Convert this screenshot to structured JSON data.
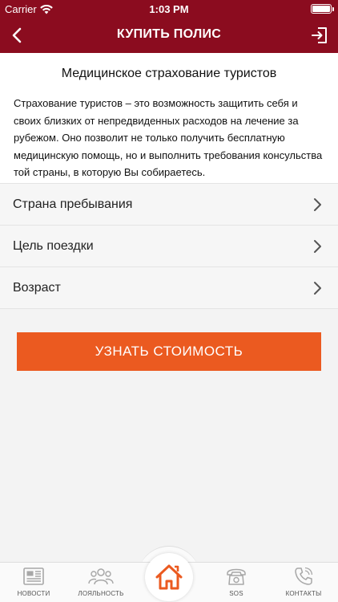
{
  "status_bar": {
    "carrier": "Carrier",
    "time": "1:03 PM"
  },
  "nav": {
    "title": "КУПИТЬ ПОЛИС",
    "back_icon": "chevron-left-icon",
    "exit_icon": "logout-icon"
  },
  "content": {
    "heading": "Медицинское страхование туристов",
    "intro": "Страхование туристов – это возможность защитить себя и своих близких от непредвиденных расходов на лечение за рубежом. Оно позволит не только получить бесплатную медицинскую помощь, но и выполнить требования консульства той страны, в которую Вы собираетесь."
  },
  "options": [
    {
      "label": "Страна пребывания"
    },
    {
      "label": "Цель поездки"
    },
    {
      "label": "Возраст"
    }
  ],
  "cta": {
    "label": "УЗНАТЬ СТОИМОСТЬ"
  },
  "tabs": [
    {
      "label": "НОВОСТИ",
      "icon": "newspaper-icon"
    },
    {
      "label": "ЛОЯЛЬНОСТЬ",
      "icon": "people-icon"
    },
    {
      "label": "",
      "icon": "home-icon"
    },
    {
      "label": "SOS",
      "icon": "phone-icon"
    },
    {
      "label": "КОНТАКТЫ",
      "icon": "handset-icon"
    }
  ],
  "colors": {
    "brand": "#8b0c1f",
    "accent": "#eb5a20",
    "home_icon": "#eb5a20"
  }
}
